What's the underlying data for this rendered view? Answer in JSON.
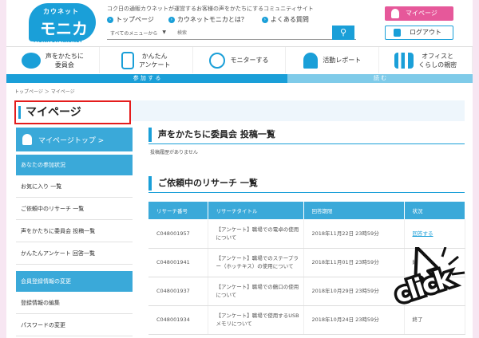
{
  "header": {
    "logo_top": "カウネット",
    "logo_main": "モニカ",
    "logo_sub": "MONITOR KAUNET",
    "tagline": "コク日の通販カウネットが運営するお客様の声をかたちにするコミュニティサイト",
    "links": [
      "トップページ",
      "カウネットモニカとは？",
      "よくある質問"
    ],
    "search_select": "すべてのメニューから",
    "search_placeholder": "検索",
    "mypage_button": "マイページ",
    "logout_button": "ログアウト"
  },
  "nav": {
    "items": [
      {
        "label": "声をかたちに\n委員会"
      },
      {
        "label": "かんたん\nアンケート"
      },
      {
        "label": "モニターする"
      },
      {
        "label": "活動レポート"
      },
      {
        "label": "オフィスと\nくらしの親密"
      }
    ],
    "bar_left": "参 加 す る",
    "bar_right": "読 む"
  },
  "breadcrumb": "トップページ ＞ マイページ",
  "page_title": "マイページ",
  "sidebar": {
    "top_label": "マイページトップ >",
    "section1": "あなたの参加状況",
    "items1": [
      "お気に入り 一覧",
      "ご依頼中のリサーチ 一覧",
      "声をかたちに委員会 投稿一覧",
      "かんたんアンケート 回答一覧"
    ],
    "section2": "会員登録情報の変更",
    "items2": [
      "登録情報の編集",
      "パスワードの変更"
    ]
  },
  "main": {
    "section1_title": "声をかたちに委員会 投稿一覧",
    "no_posts": "投稿履歴がありません",
    "section2_title": "ご依頼中のリサーチ 一覧",
    "table": {
      "headers": [
        "リサーチ番号",
        "リサーチタイトル",
        "回答期限",
        "状況"
      ],
      "rows": [
        [
          "C048001957",
          "【アンケート】職場での電卓の使用について",
          "2018年11月22日 23時59分",
          "回答する"
        ],
        [
          "C048001941",
          "【アンケート】職場でのステープラー（ホッチキス）の使用について",
          "2018年11月01日 23時59分",
          "終了"
        ],
        [
          "C048001937",
          "【アンケート】職場での鶴口の使用について",
          "2018年10月29日 23時59分",
          "終了"
        ],
        [
          "C048001934",
          "【アンケート】職場で使用するUSBメモリについて",
          "2018年10月24日 23時59分",
          "終了"
        ]
      ]
    }
  },
  "annotation": {
    "click_text": "click"
  },
  "colors": {
    "accent": "#1a9fd8",
    "highlight": "#e41c1c",
    "pink": "#e6589a"
  }
}
